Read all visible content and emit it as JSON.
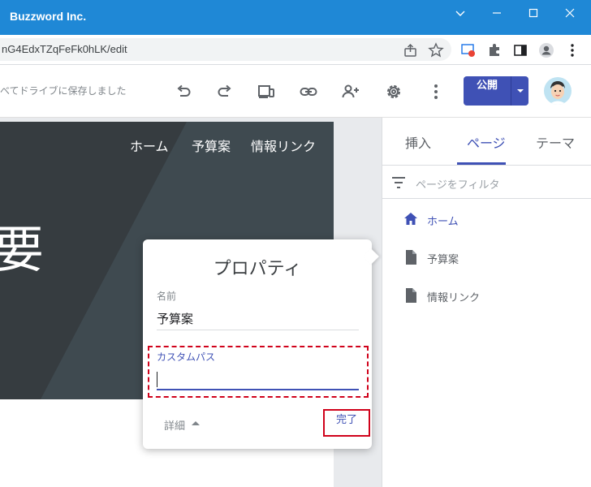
{
  "window": {
    "title": "Buzzword Inc.",
    "controls": [
      "chevron-down-icon",
      "minimize-icon",
      "maximize-icon",
      "close-icon"
    ]
  },
  "browser": {
    "url": "nG4EdxTZqFeFk0hLK/edit"
  },
  "toolbar": {
    "save_status": "べてドライブに保存しました",
    "publish_label": "公開"
  },
  "site": {
    "nav": [
      "ホーム",
      "予算案",
      "情報リンク"
    ],
    "banner_text": "要"
  },
  "properties_dialog": {
    "title": "プロパティ",
    "name_label": "名前",
    "name_value": "予算案",
    "custom_path_label": "カスタムパス",
    "custom_path_value": "",
    "details_label": "詳細",
    "done_label": "完了"
  },
  "panel": {
    "tabs": [
      "挿入",
      "ページ",
      "テーマ"
    ],
    "active_tab": "ページ",
    "filter_placeholder": "ページをフィルタ",
    "pages": [
      {
        "label": "ホーム",
        "icon": "home-icon",
        "active": true
      },
      {
        "label": "予算案",
        "icon": "page-icon",
        "active": false
      },
      {
        "label": "情報リンク",
        "icon": "page-icon",
        "active": false
      }
    ]
  },
  "colors": {
    "titlebar": "#1f88d6",
    "accent": "#3f51b5",
    "highlight": "#d0021b",
    "banner": "#363c40"
  }
}
